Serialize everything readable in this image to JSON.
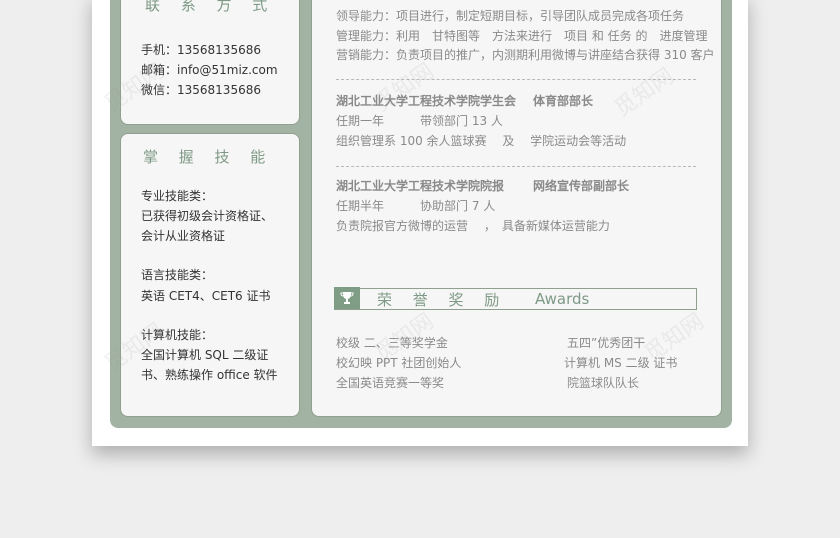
{
  "contact": {
    "title": "联 系 方 式",
    "phone": "手机：13568135686",
    "email": "邮箱：info@51miz.com",
    "wechat": "微信：13568135686"
  },
  "skills": {
    "title": "掌 握 技 能",
    "lines": [
      "专业技能类：",
      "已获得初级会计资格证、",
      "会计从业资格证",
      "语言技能类：",
      "英语 CET4、CET6 证书",
      "计算机技能：",
      "全国计算机 SQL 二级证",
      "书、熟练操作 office 软件"
    ]
  },
  "abilities": [
    "领导能力：项目进行，制定短期目标，引导团队成员完成各项任务",
    "管理能力：利用　甘特图等　方法来进行　项目 和 任务 的　进度管理",
    "营销能力：负责项目的推广，内测期利用微博与讲座结合获得 310 客户"
  ],
  "experience": [
    {
      "org": "湖北工业大学工程技术学院学生会",
      "role": "体育部部长",
      "line1": "任期一年　　　带领部门 13 人",
      "line2": "组织管理系 100 余人篮球赛　 及　 学院运动会等活动"
    },
    {
      "org": "湖北工业大学工程技术学院院报",
      "role": "网络宣传部副部长",
      "line1": "任期半年　　　协助部门 7 人",
      "line2": "负责院报官方微博的运营　 ，　具备新媒体运营能力"
    }
  ],
  "awards": {
    "title": "荣 誉 奖 励",
    "title_en": "Awards",
    "left": [
      "校级 二、三等奖学金",
      "校幻映 PPT 社团创始人",
      "全国英语竞赛一等奖"
    ],
    "right": [
      "五四”优秀团干",
      "计算机 MS 二级 证书",
      "院篮球队队长"
    ]
  },
  "watermark": "觅知网"
}
